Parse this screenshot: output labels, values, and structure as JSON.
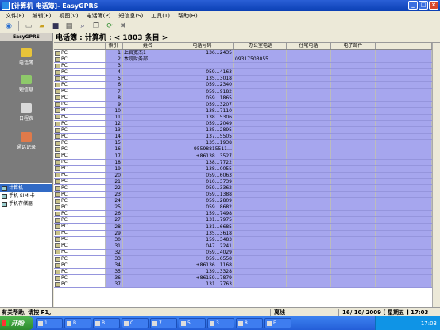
{
  "window": {
    "title": "[计算机 电话簿]- EasyGPRS"
  },
  "menu": [
    "文件(F)",
    "编辑(E)",
    "视图(V)",
    "电话簿(P)",
    "短信息(S)",
    "工具(T)",
    "帮助(H)"
  ],
  "sidebar": {
    "header": "EasyGPRS",
    "items": [
      {
        "label": "电话簿",
        "icon": "phonebook-icon"
      },
      {
        "label": "短信息",
        "icon": "sms-icon"
      },
      {
        "label": "日程表",
        "icon": "calendar-icon"
      },
      {
        "label": "通话记录",
        "icon": "call-log-icon"
      }
    ],
    "tree": [
      "计算机",
      "手机 SIM 卡",
      "手机存储器"
    ]
  },
  "main": {
    "heading": "电话簿 : 计算机 : < 1803 条目 >",
    "columns": [
      "索引",
      "姓名",
      "电话号码",
      "办公室电话",
      "住宅电话",
      "电子邮件"
    ],
    "rows": [
      {
        "src": "PC",
        "idx": "1",
        "name": "上官宽杰1",
        "phone": "136…2435",
        "office": "",
        "home": "",
        "email": ""
      },
      {
        "src": "PC",
        "idx": "2",
        "name": "本院财务部",
        "phone": "",
        "office": "09317503055",
        "home": "",
        "email": ""
      },
      {
        "src": "PC",
        "idx": "3",
        "name": "",
        "phone": "",
        "office": "",
        "home": "",
        "email": ""
      },
      {
        "src": "PC",
        "idx": "4",
        "name": "",
        "phone": "059…4163",
        "office": "",
        "home": "",
        "email": ""
      },
      {
        "src": "PC",
        "idx": "5",
        "name": "",
        "phone": "135…3018",
        "office": "",
        "home": "",
        "email": ""
      },
      {
        "src": "PC",
        "idx": "6",
        "name": "",
        "phone": "059…2340",
        "office": "",
        "home": "",
        "email": ""
      },
      {
        "src": "PC",
        "idx": "7",
        "name": "",
        "phone": "059…9182",
        "office": "",
        "home": "",
        "email": ""
      },
      {
        "src": "PC",
        "idx": "8",
        "name": "",
        "phone": "059…1865",
        "office": "",
        "home": "",
        "email": ""
      },
      {
        "src": "PC",
        "idx": "9",
        "name": "",
        "phone": "059…3207",
        "office": "",
        "home": "",
        "email": ""
      },
      {
        "src": "PC",
        "idx": "10",
        "name": "",
        "phone": "138…7110",
        "office": "",
        "home": "",
        "email": ""
      },
      {
        "src": "PC",
        "idx": "11",
        "name": "",
        "phone": "138…5306",
        "office": "",
        "home": "",
        "email": ""
      },
      {
        "src": "PC",
        "idx": "12",
        "name": "",
        "phone": "059…2049",
        "office": "",
        "home": "",
        "email": ""
      },
      {
        "src": "PC",
        "idx": "13",
        "name": "",
        "phone": "135…2895",
        "office": "",
        "home": "",
        "email": ""
      },
      {
        "src": "PC",
        "idx": "14",
        "name": "",
        "phone": "137…5505",
        "office": "",
        "home": "",
        "email": ""
      },
      {
        "src": "PC",
        "idx": "15",
        "name": "",
        "phone": "135…1938",
        "office": "",
        "home": "",
        "email": ""
      },
      {
        "src": "PC",
        "idx": "16",
        "name": "",
        "phone": "95598815511…",
        "office": "",
        "home": "",
        "email": ""
      },
      {
        "src": "PC",
        "idx": "17",
        "name": "",
        "phone": "+86138…3527",
        "office": "",
        "home": "",
        "email": ""
      },
      {
        "src": "PC",
        "idx": "18",
        "name": "",
        "phone": "138…7722",
        "office": "",
        "home": "",
        "email": ""
      },
      {
        "src": "PC",
        "idx": "19",
        "name": "",
        "phone": "138…0055",
        "office": "",
        "home": "",
        "email": ""
      },
      {
        "src": "PC",
        "idx": "20",
        "name": "",
        "phone": "059…6063",
        "office": "",
        "home": "",
        "email": ""
      },
      {
        "src": "PC",
        "idx": "21",
        "name": "",
        "phone": "010…3739",
        "office": "",
        "home": "",
        "email": ""
      },
      {
        "src": "PC",
        "idx": "22",
        "name": "",
        "phone": "059…3362",
        "office": "",
        "home": "",
        "email": ""
      },
      {
        "src": "PC",
        "idx": "23",
        "name": "",
        "phone": "059…1388",
        "office": "",
        "home": "",
        "email": ""
      },
      {
        "src": "PC",
        "idx": "24",
        "name": "",
        "phone": "059…2809",
        "office": "",
        "home": "",
        "email": ""
      },
      {
        "src": "PC",
        "idx": "25",
        "name": "",
        "phone": "059…8682",
        "office": "",
        "home": "",
        "email": ""
      },
      {
        "src": "PC",
        "idx": "26",
        "name": "",
        "phone": "159…7498",
        "office": "",
        "home": "",
        "email": ""
      },
      {
        "src": "PC",
        "idx": "27",
        "name": "",
        "phone": "131…7975",
        "office": "",
        "home": "",
        "email": ""
      },
      {
        "src": "PC",
        "idx": "28",
        "name": "",
        "phone": "131…6685",
        "office": "",
        "home": "",
        "email": ""
      },
      {
        "src": "PC",
        "idx": "29",
        "name": "",
        "phone": "135…3618",
        "office": "",
        "home": "",
        "email": ""
      },
      {
        "src": "PC",
        "idx": "30",
        "name": "",
        "phone": "159…3483",
        "office": "",
        "home": "",
        "email": ""
      },
      {
        "src": "PC",
        "idx": "31",
        "name": "",
        "phone": "047…2241",
        "office": "",
        "home": "",
        "email": ""
      },
      {
        "src": "PC",
        "idx": "32",
        "name": "",
        "phone": "059…4029",
        "office": "",
        "home": "",
        "email": ""
      },
      {
        "src": "PC",
        "idx": "33",
        "name": "",
        "phone": "059…6558",
        "office": "",
        "home": "",
        "email": ""
      },
      {
        "src": "PC",
        "idx": "34",
        "name": "",
        "phone": "+86136…1168",
        "office": "",
        "home": "",
        "email": ""
      },
      {
        "src": "PC",
        "idx": "35",
        "name": "",
        "phone": "139…3328",
        "office": "",
        "home": "",
        "email": ""
      },
      {
        "src": "PC",
        "idx": "36",
        "name": "",
        "phone": "+86159…7879",
        "office": "",
        "home": "",
        "email": ""
      },
      {
        "src": "PC",
        "idx": "37",
        "name": "",
        "phone": "131…7763",
        "office": "",
        "home": "",
        "email": ""
      }
    ]
  },
  "status": {
    "help": "有关帮助, 请按 F1。",
    "conn": "离线",
    "datetime": "16/ 10/ 2009 [ 星期五 ] 17:03"
  },
  "taskbar": {
    "start": "开始",
    "tasks": [
      "1",
      "B",
      "B",
      "C",
      "7",
      "5",
      "3",
      "8",
      "E"
    ],
    "clock": "17:03"
  }
}
